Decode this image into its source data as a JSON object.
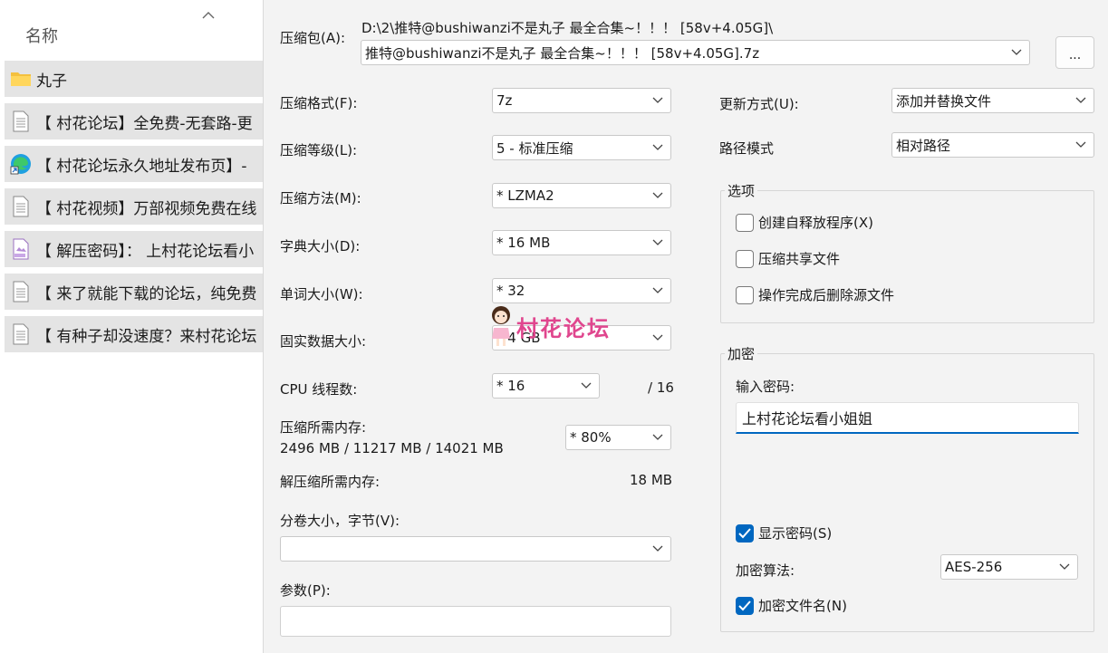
{
  "explorer": {
    "column_header": "名称",
    "items": [
      {
        "name": "丸子",
        "icon": "folder-icon"
      },
      {
        "name": "【 村花论坛】全免费-无套路-更",
        "icon": "text-file-icon"
      },
      {
        "name": "【 村花论坛永久地址发布页】-",
        "icon": "edge-shortcut-icon"
      },
      {
        "name": "【 村花视频】万部视频免费在线",
        "icon": "text-file-icon"
      },
      {
        "name": "【 解压密码】： 上村花论坛看小",
        "icon": "jpg-file-icon"
      },
      {
        "name": "【 来了就能下载的论坛，纯免费",
        "icon": "text-file-icon"
      },
      {
        "name": "【 有种子却没速度？来村花论坛",
        "icon": "text-file-icon"
      }
    ]
  },
  "dialog": {
    "archive": {
      "label": "压缩包(A):",
      "path": "D:\\2\\推特@bushiwanzi不是丸子 最全合集~！！！ [58v+4.05G]\\",
      "name": "推特@bushiwanzi不是丸子 最全合集~！！！ [58v+4.05G].7z",
      "browse_label": "..."
    },
    "format": {
      "label": "压缩格式(F):",
      "value": "7z"
    },
    "level": {
      "label": "压缩等级(L):",
      "value": "5 - 标准压缩"
    },
    "method": {
      "label": "压缩方法(M):",
      "value": "*  LZMA2"
    },
    "dict": {
      "label": "字典大小(D):",
      "value": "*  16 MB"
    },
    "word": {
      "label": "单词大小(W):",
      "value": "*  32"
    },
    "solid": {
      "label": "固实数据大小:",
      "value": "*  4 GB"
    },
    "cpu": {
      "label": "CPU 线程数:",
      "value": "*  16",
      "total": "/ 16"
    },
    "mem_comp": {
      "label": "压缩所需内存:",
      "detail": "2496 MB / 11217 MB / 14021 MB",
      "value": "* 80%"
    },
    "mem_decomp": {
      "label": "解压缩所需内存:",
      "value": "18 MB"
    },
    "volume": {
      "label": "分卷大小，字节(V):",
      "value": ""
    },
    "params": {
      "label": "参数(P):",
      "value": ""
    },
    "update": {
      "label": "更新方式(U):",
      "value": "添加并替换文件"
    },
    "path_mode": {
      "label": "路径模式",
      "value": "相对路径"
    },
    "options": {
      "title": "选项",
      "items": [
        {
          "label": "创建自释放程序(X)",
          "checked": false
        },
        {
          "label": "压缩共享文件",
          "checked": false
        },
        {
          "label": "操作完成后删除源文件",
          "checked": false
        }
      ]
    },
    "encryption": {
      "title": "加密",
      "password_label": "输入密码:",
      "password_value": "上村花论坛看小姐姐",
      "show_password": {
        "label": "显示密码(S)",
        "checked": true
      },
      "method_label": "加密算法:",
      "method_value": "AES-256",
      "encrypt_names": {
        "label": "加密文件名(N)",
        "checked": true
      }
    }
  },
  "watermark": {
    "text": "村花论坛"
  },
  "colors": {
    "accent": "#0067c0",
    "watermark": "#e0468e",
    "selection": "#e4e4e4"
  }
}
